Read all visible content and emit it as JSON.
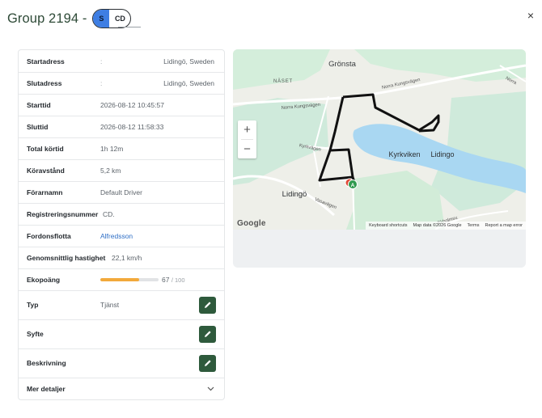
{
  "header": {
    "title": "Group 2194 -",
    "toggle": {
      "left": "S",
      "right": "CD"
    },
    "close_symbol": "×"
  },
  "details": {
    "start_address": {
      "label": "Startadress",
      "colon": ":",
      "value": "Lidingö, Sweden"
    },
    "end_address": {
      "label": "Slutadress",
      "colon": ":",
      "value": "Lidingö, Sweden"
    },
    "start_time": {
      "label": "Starttid",
      "value": "2026-08-12 10:45:57"
    },
    "end_time": {
      "label": "Sluttid",
      "value": "2026-08-12 11:58:33"
    },
    "total_drive_time": {
      "label": "Total körtid",
      "value": "1h 12m"
    },
    "distance": {
      "label": "Köravstånd",
      "value": "5,2 km"
    },
    "driver": {
      "label": "Förarnamn",
      "value": "Default Driver"
    },
    "registration": {
      "label": "Registreringsnummer",
      "value": "CD."
    },
    "fleet": {
      "label": "Fordonsflotta",
      "value": "Alfredsson"
    },
    "avg_speed": {
      "label": "Genomsnittlig hastighet",
      "value": "22,1 km/h"
    },
    "eco_score": {
      "label": "Ekopoäng",
      "value": "67",
      "max": "/ 100",
      "fraction": 0.67,
      "color": "#f2a93b"
    },
    "type": {
      "label": "Typ",
      "value": "Tjänst"
    },
    "purpose": {
      "label": "Syfte",
      "value": ""
    },
    "description": {
      "label": "Beskrivning",
      "value": ""
    },
    "more": {
      "label": "Mer detaljer"
    }
  },
  "map": {
    "labels": {
      "gronsta": "Grönsta",
      "naset": "NÄSET",
      "norra_kungsvagen_1": "Norra Kungsvägen",
      "norra_kungsvagen_2": "Norra Kungsvägen",
      "norra_3": "Norra",
      "kyrkvagen": "Kyrkvägen",
      "kyrkviken": "Kyrkviken",
      "lidingo_east": "Lidingo",
      "lidingo_south": "Lidingö",
      "vasavagen": "Vasavägen",
      "ekholmsv": "Ekholmsv.",
      "marker": "A"
    },
    "zoom_in": "+",
    "zoom_out": "−",
    "google": "Google",
    "attribution": {
      "shortcuts": "Keyboard shortcuts",
      "data": "Map data ©2026 Google",
      "terms": "Terms",
      "report": "Report a map error"
    }
  },
  "colors": {
    "title": "#2e4a37",
    "toggle_active": "#3e7ee3",
    "edit_button": "#2e5a3c",
    "link": "#2f6fc6",
    "route": "#111111",
    "water": "#a9d7f2",
    "park": "#cdebd3"
  }
}
